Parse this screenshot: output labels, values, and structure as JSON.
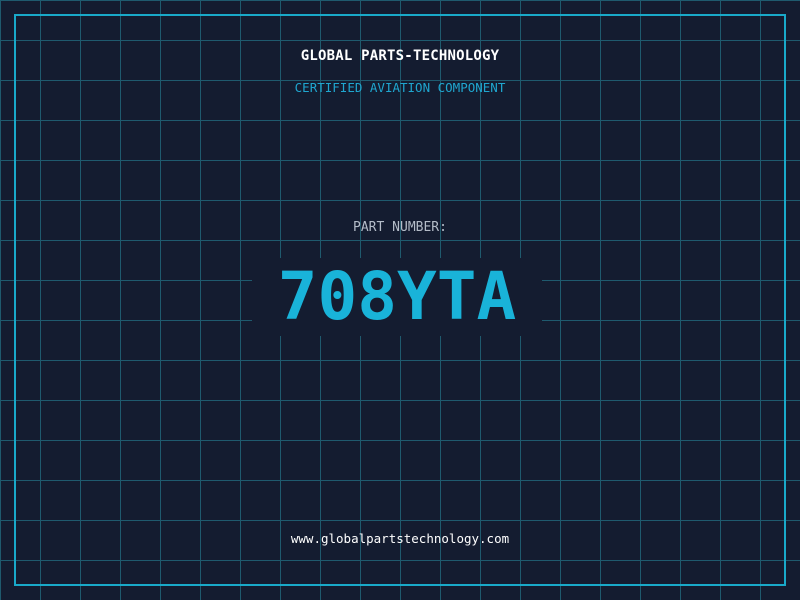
{
  "header": {
    "title": "GLOBAL PARTS-TECHNOLOGY",
    "subtitle": "CERTIFIED AVIATION COMPONENT"
  },
  "part": {
    "label": "PART NUMBER:",
    "number": "708YTA"
  },
  "footer": {
    "url": "www.globalpartstechnology.com"
  },
  "colors": {
    "background": "#141c30",
    "grid": "#1f5a6e",
    "accent": "#19b3d9",
    "border": "#19a9c9",
    "title_text": "#ffffff",
    "label_text": "#b4bcc8"
  }
}
